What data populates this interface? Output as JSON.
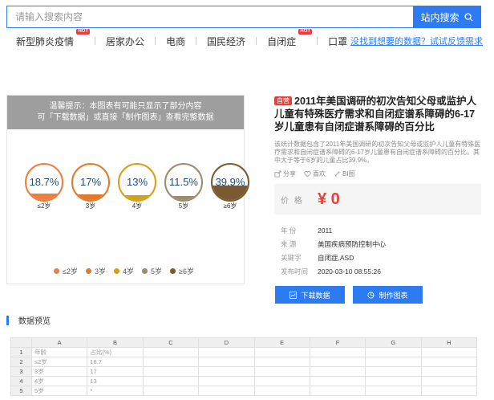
{
  "search": {
    "placeholder": "请输入搜索内容",
    "button_label": "站内搜索"
  },
  "hot_keywords": [
    {
      "label": "新型肺炎疫情",
      "hot": "HOT"
    },
    {
      "label": "居家办公",
      "hot": ""
    },
    {
      "label": "电商",
      "hot": ""
    },
    {
      "label": "国民经济",
      "hot": ""
    },
    {
      "label": "自闭症",
      "hot": "HOT"
    },
    {
      "label": "口罩",
      "hot": ""
    }
  ],
  "feedback_link": "没找到想要的数据？试试反馈需求",
  "preview": {
    "notice_line1": "温馨提示：本图表有可能只显示了部分内容",
    "notice_line2": "可「下载数据」或直接「制作图表」查看完整数据"
  },
  "chart_data": {
    "type": "bubble-gauge",
    "categories": [
      "≤2岁",
      "3岁",
      "4岁",
      "5岁",
      "≥6岁"
    ],
    "values": [
      18.7,
      17,
      13,
      11.5,
      39.9
    ],
    "value_labels": [
      "18.7%",
      "17%",
      "13%",
      "11.5%",
      "39.9%"
    ],
    "colors": [
      "#ee7d3e",
      "#e07a2a",
      "#d4a017",
      "#9c8b6e",
      "#7a5a32"
    ],
    "legend": [
      "≤2岁",
      "3岁",
      "4岁",
      "5岁",
      "≥6岁"
    ]
  },
  "detail": {
    "tag": "自营",
    "title": "2011年美国调研的初次告知父母或监护人儿童有特殊医疗需求和自闭症谱系障碍的6-17岁儿童患有自闭症谱系障碍的百分比",
    "description": "该统计数据包含了2011年美国调研的初次告知父母或监护人儿童有特殊医疗需求和自闭症谱系障碍的6-17岁儿童患有自闭症谱系障碍的百分比。其中大于等于6岁的儿童占比39.9%。",
    "share_label": "分享",
    "like_label": "喜欢",
    "bd_label": "BI图"
  },
  "price": {
    "label": "价 格",
    "value": "¥ 0"
  },
  "info": [
    {
      "key": "年 份",
      "value": "2011"
    },
    {
      "key": "来 源",
      "value": "美国疾病预防控制中心"
    },
    {
      "key": "关键字",
      "value": "自闭症,ASD"
    },
    {
      "key": "发布时间",
      "value": "2020-03-10 08:55:26"
    }
  ],
  "buttons": {
    "download": "下载数据",
    "make_chart": "制作图表"
  },
  "data_preview": {
    "title": "数据预览",
    "columns": [
      "",
      "A",
      "B",
      "C",
      "D",
      "E",
      "F",
      "G",
      "H"
    ],
    "rows": [
      [
        "1",
        "年龄",
        "占比(%)"
      ],
      [
        "2",
        "≤2岁",
        "18.7"
      ],
      [
        "3",
        "3岁",
        "17"
      ],
      [
        "4",
        "4岁",
        "13"
      ],
      [
        "5",
        "5岁",
        "*"
      ]
    ]
  }
}
